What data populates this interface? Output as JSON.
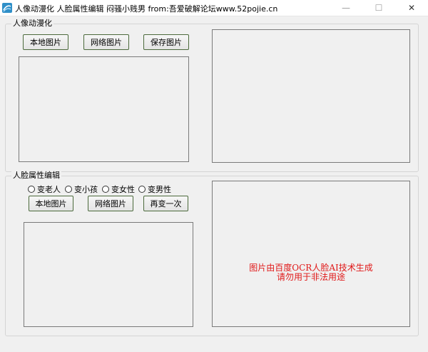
{
  "window": {
    "title": "人像动漫化 人脸属性编辑 闷骚小贱男 from:吾爱破解论坛www.52pojie.cn",
    "icon": "app-logo-icon",
    "controls": {
      "minimize": "—",
      "maximize": "☐",
      "close": "✕"
    }
  },
  "anime_group": {
    "title": "人像动漫化",
    "buttons": {
      "local": "本地图片",
      "network": "网络图片",
      "save": "保存图片"
    }
  },
  "face_group": {
    "title": "人脸属性编辑",
    "radios": [
      "变老人",
      "变小孩",
      "变女性",
      "变男性"
    ],
    "buttons": {
      "local": "本地图片",
      "network": "网络图片",
      "again": "再变一次"
    },
    "notice_line1": "图片由百度OCR人脸AI技术生成",
    "notice_line2": "请勿用于非法用途"
  },
  "colors": {
    "notice": "#e01818",
    "button_border": "#4c6a3c"
  }
}
